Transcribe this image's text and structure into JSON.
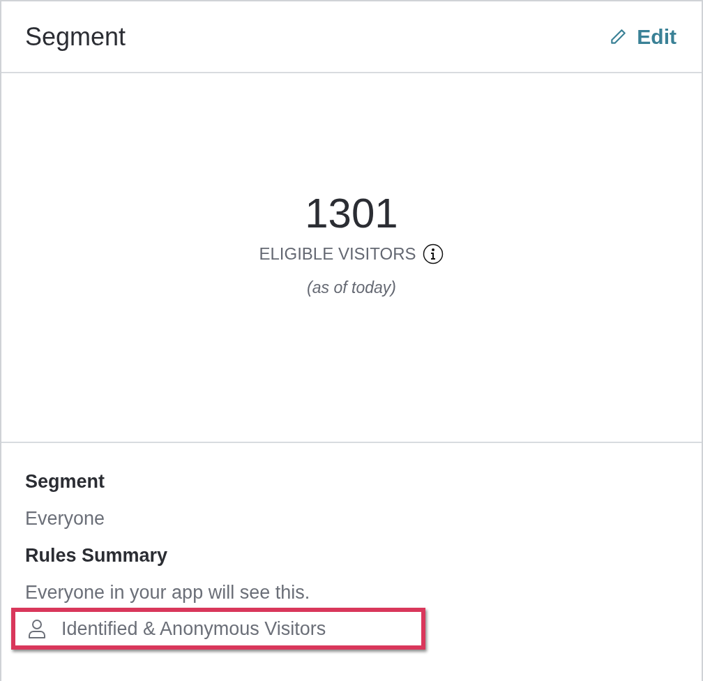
{
  "header": {
    "title": "Segment",
    "action": "Edit"
  },
  "stats": {
    "count": "1301",
    "label": "ELIGIBLE VISITORS",
    "note": "(as of today)"
  },
  "details": [
    {
      "heading": "Segment",
      "value": "Everyone"
    },
    {
      "heading": "Rules Summary",
      "value": "Everyone in your app will see this."
    }
  ],
  "audience": {
    "label": "Identified & Anonymous Visitors",
    "highlighted": true
  }
}
